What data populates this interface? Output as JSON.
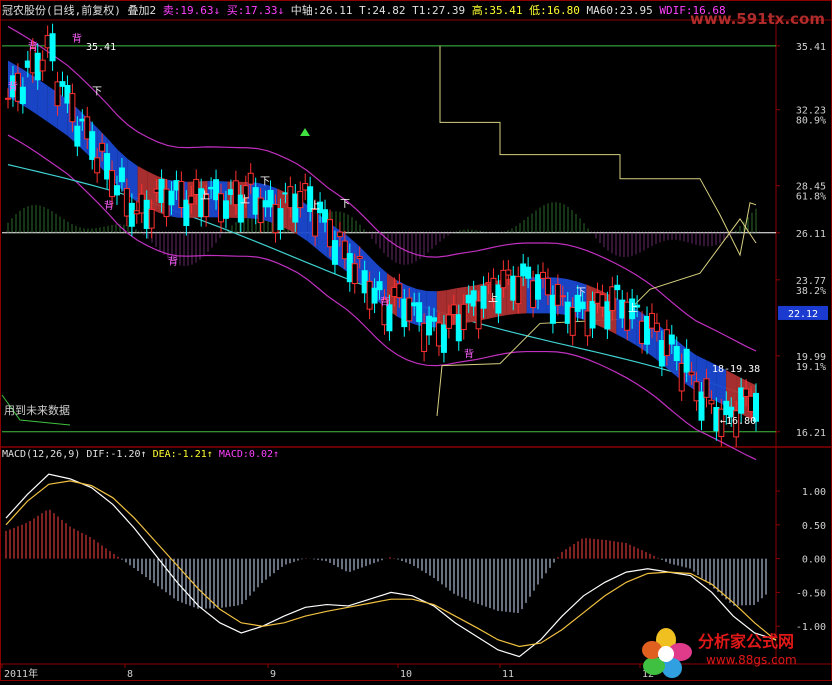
{
  "header": {
    "stock": "冠农股份(日线,前复权)",
    "overlay": "叠加2",
    "sell_label": "卖:",
    "sell_value": "19.63↓",
    "buy_label": "买:",
    "buy_value": "17.33↓",
    "mid_label": "中轴:",
    "mid_value": "26.11",
    "t_label": "T:",
    "t_value": "24.82",
    "t1_label": "T1:",
    "t1_value": "27.39",
    "high_label": "高:",
    "high_value": "35.41",
    "low_label": "低:",
    "low_value": "16.80",
    "ma60_label": "MA60:",
    "ma60_value": "23.95",
    "wdif_label": "WDIF:",
    "wdif_value": "16.68"
  },
  "macd_header": {
    "name": "MACD(12,26,9)",
    "dif_label": "DIF:",
    "dif_value": "-1.20↑",
    "dea_label": "DEA:",
    "dea_value": "-1.21↑",
    "macd_label": "MACD:",
    "macd_value": "0.02↑"
  },
  "annotations": {
    "future_data": "用到未来数据",
    "high_marker": "35.41",
    "low_marker": "←16.80",
    "range_marker": "18-19.38",
    "bei": "背",
    "shang": "上",
    "xia": "下"
  },
  "current_price": "22.12",
  "watermark": "www.591tx.com",
  "logo": {
    "line1": "分析家公式网",
    "line2": "www.88gs.com"
  },
  "colors": {
    "up": "#ff3030",
    "down": "#00ffff",
    "ribbon_down": "#1a48d0",
    "ribbon_up": "#b03030",
    "ma_cyan": "#40d0d0",
    "band_magenta": "#c030c0",
    "tline": "#d8d080",
    "grid": "#8b0000"
  },
  "chart_data": {
    "type": "candlestick",
    "price_axis": {
      "ticks": [
        35.41,
        32.23,
        28.45,
        26.11,
        23.77,
        22.12,
        19.99,
        16.21
      ],
      "pct_ticks": [
        "80.9%",
        "61.8%",
        "38.2%",
        "19.1%"
      ]
    },
    "x_ticks": [
      "2011年",
      "8",
      "9",
      "10",
      "11",
      "12"
    ],
    "macd_axis": {
      "ticks": [
        1.0,
        0.5,
        0.0,
        -0.5,
        -1.0
      ],
      "labels": [
        "1.00",
        "0.50",
        "0.00",
        "-0.50",
        "-1.00"
      ]
    },
    "close_path": [
      32.8,
      33.5,
      34.2,
      34.8,
      35.1,
      33.6,
      32.4,
      31.5,
      30.8,
      29.9,
      29.1,
      28.4,
      27.6,
      27.0,
      27.3,
      27.8,
      28.1,
      27.9,
      27.7,
      27.8,
      28.0,
      27.8,
      27.6,
      27.9,
      28.2,
      27.8,
      27.3,
      27.2,
      27.6,
      27.9,
      27.8,
      27.2,
      26.4,
      25.6,
      24.9,
      24.3,
      23.6,
      22.9,
      22.4,
      22.8,
      22.6,
      22.0,
      21.5,
      21.2,
      21.4,
      21.8,
      22.3,
      22.6,
      23.0,
      23.4,
      23.6,
      23.7,
      23.8,
      23.6,
      23.4,
      22.9,
      22.4,
      22.2,
      22.1,
      22.3,
      22.6,
      22.8,
      22.5,
      22.0,
      21.6,
      21.2,
      20.7,
      20.2,
      19.5,
      18.6,
      17.9,
      17.4,
      16.8,
      17.2,
      17.6,
      17.9
    ],
    "macd_dif": [
      0.6,
      0.95,
      1.25,
      1.18,
      1.05,
      0.8,
      0.45,
      0.05,
      -0.35,
      -0.7,
      -0.95,
      -1.1,
      -1.0,
      -0.85,
      -0.72,
      -0.68,
      -0.7,
      -0.6,
      -0.5,
      -0.55,
      -0.7,
      -0.95,
      -1.15,
      -1.35,
      -1.45,
      -1.2,
      -0.85,
      -0.55,
      -0.35,
      -0.2,
      -0.15,
      -0.2,
      -0.25,
      -0.5,
      -0.85,
      -1.1,
      -1.2
    ],
    "macd_dea": [
      0.5,
      0.85,
      1.1,
      1.15,
      1.08,
      0.9,
      0.6,
      0.25,
      -0.1,
      -0.45,
      -0.75,
      -0.95,
      -1.0,
      -0.95,
      -0.85,
      -0.78,
      -0.72,
      -0.66,
      -0.6,
      -0.6,
      -0.68,
      -0.85,
      -1.02,
      -1.2,
      -1.3,
      -1.25,
      -1.05,
      -0.8,
      -0.55,
      -0.35,
      -0.22,
      -0.2,
      -0.22,
      -0.38,
      -0.65,
      -0.95,
      -1.21
    ]
  }
}
